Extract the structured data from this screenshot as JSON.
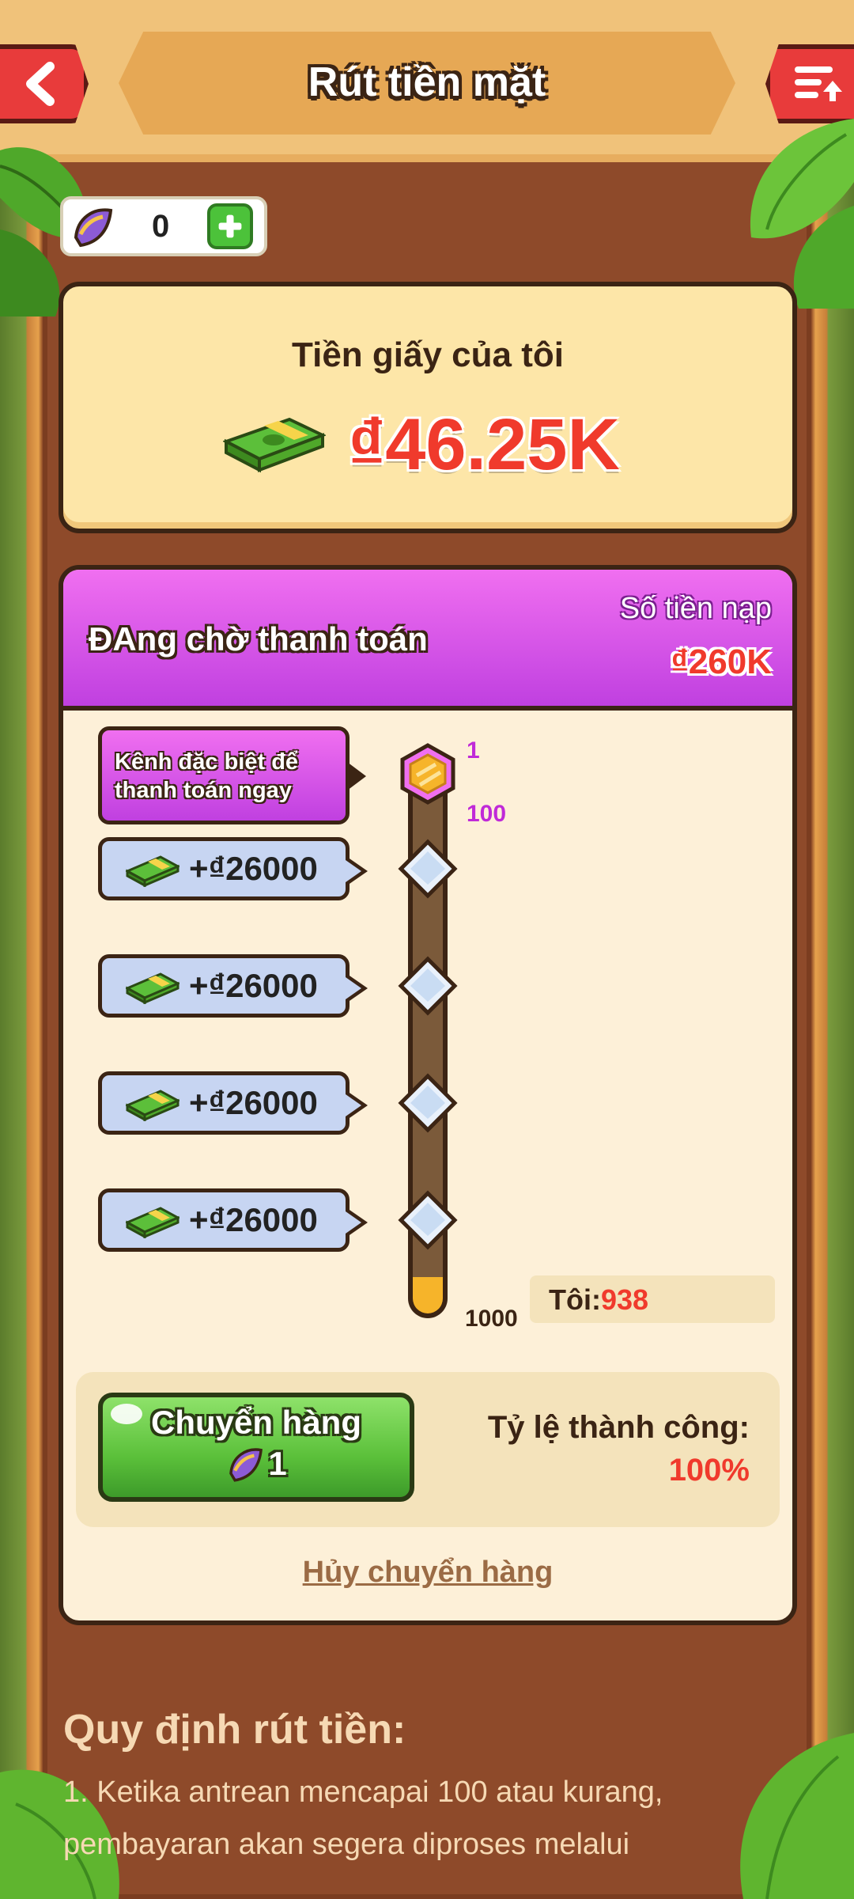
{
  "header": {
    "title": "Rút tiền mặt",
    "back_icon": "back-arrow-icon",
    "menu_icon": "list-upload-icon"
  },
  "tickets": {
    "icon": "ticket-icon",
    "count": "0",
    "add_icon": "plus-icon"
  },
  "balance": {
    "label": "Tiền giấy của tôi",
    "value": "₫46.25K",
    "icon": "money-stack-icon"
  },
  "progress": {
    "title": "ĐAng chờ thanh toán",
    "deposit_label": "Số tiền nạp",
    "deposit_value": "₫260K",
    "special_channel": "Kênh đặc biệt để thanh toán ngay",
    "node_top_label": "1",
    "node_second_label": "100",
    "end_label": "1000",
    "rewards": [
      {
        "text": "+₫26000"
      },
      {
        "text": "+₫26000"
      },
      {
        "text": "+₫26000"
      },
      {
        "text": "+₫26000"
      }
    ],
    "me_label": "Tôi:",
    "me_value": "938",
    "colors": {
      "accent": "#c040e0",
      "red": "#f03a2c",
      "green": "#5bc03a"
    }
  },
  "ship": {
    "button_label": "Chuyển hàng",
    "cost": "1",
    "rate_label": "Tỷ lệ thành công:",
    "rate_value": "100%",
    "cancel_label": "Hủy chuyển hàng"
  },
  "rules": {
    "title": "Quy định rút tiền:",
    "text": "1. Ketika antrean mencapai 100 atau kurang, pembayaran akan segera diproses melalui"
  }
}
